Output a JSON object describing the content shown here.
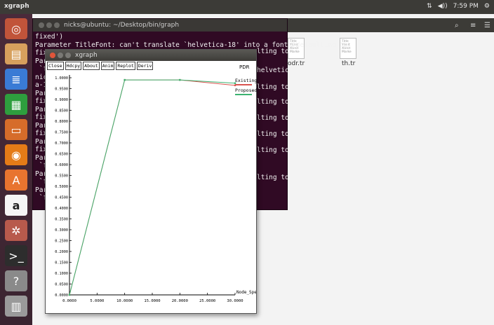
{
  "topbar": {
    "app_name": "xgraph",
    "time": "7:59 PM",
    "network": "⇅",
    "volume": "◀))"
  },
  "launcher": {
    "items": [
      "ubuntu-logo",
      "files",
      "writer",
      "calc",
      "impress",
      "firefox",
      "software-center",
      "amazon",
      "settings",
      "terminal",
      "help",
      "trash"
    ]
  },
  "terminal": {
    "title": "nicks@ubuntu: ~/Desktop/bin/graph",
    "lines": [
      "fixed')",
      "Parameter TitleFont: can't translate `helvetica-18' into a font (defaulting to",
      "fixed')",
      "Para",
      " `fal",
      "nicks",
      "a-10",
      "Para",
      "fixe",
      "Para",
      "fixe",
      "Para",
      "fixe",
      "Para",
      "fixe",
      "Para",
      " `fal",
      "Para",
      " `fal",
      "Para",
      " `fal"
    ],
    "right_fragments": [
      "lting to",
      "helvetic",
      "lting to",
      "lting to",
      "lting to",
      "lting to",
      "lting to",
      "lting to"
    ]
  },
  "files": {
    "items": [
      {
        "label": "odr.tr",
        "icon_text": "Title\nYUnit\nXUnit\nMarke"
      },
      {
        "label": "th.tr",
        "icon_text": "Title\nYUnit\nXUnit\nMarke"
      }
    ]
  },
  "xgraph": {
    "title": "xgraph",
    "buttons": [
      "Close",
      "Hdcpy",
      "About",
      "Anim",
      "Replot",
      "Deriv"
    ],
    "plot_title": "PDR"
  },
  "chart_data": {
    "type": "line",
    "title": "PDR",
    "xlabel": "Node_Speed",
    "ylabel": "",
    "xlim": [
      0,
      30
    ],
    "ylim": [
      0,
      1.0
    ],
    "x_ticks": [
      "0.0000",
      "5.0000",
      "10.0000",
      "15.0000",
      "20.0000",
      "25.0000",
      "30.0000"
    ],
    "y_ticks": [
      "0.0000",
      "0.0500",
      "0.1000",
      "0.1500",
      "0.2000",
      "0.2500",
      "0.3000",
      "0.3500",
      "0.4000",
      "0.4500",
      "0.5000",
      "0.5500",
      "0.6000",
      "0.6500",
      "0.7000",
      "0.7500",
      "0.8000",
      "0.8500",
      "0.9000",
      "0.9500",
      "1.0000"
    ],
    "grid": false,
    "legend_position": "top-right",
    "series": [
      {
        "name": "Existing",
        "color": "#d9534f",
        "points": [
          [
            0,
            0.0
          ],
          [
            10,
            0.99
          ],
          [
            20,
            0.99
          ],
          [
            30,
            0.965
          ]
        ]
      },
      {
        "name": "Proposed",
        "color": "#3cb371",
        "points": [
          [
            0,
            0.0
          ],
          [
            10,
            0.99
          ],
          [
            20,
            0.99
          ],
          [
            30,
            0.975
          ]
        ]
      }
    ]
  }
}
